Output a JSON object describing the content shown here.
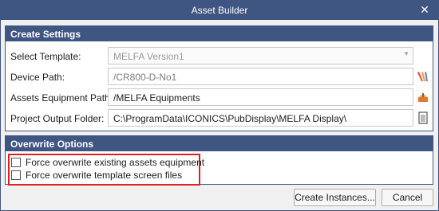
{
  "window": {
    "title": "Asset Builder",
    "close_glyph": "✕"
  },
  "create_settings": {
    "header": "Create Settings",
    "select_template": {
      "label": "Select Template:",
      "value": "MELFA Version1",
      "disabled": true
    },
    "device_path": {
      "label": "Device Path:",
      "value": "/CR800-D-No1",
      "icon": "tag-browse-icon"
    },
    "assets_equipment_path": {
      "label": "Assets Equipment Path:",
      "value": "/MELFA Equipments",
      "icon": "asset-browse-icon"
    },
    "project_output_folder": {
      "label": "Project Output Folder:",
      "value": "C:\\ProgramData\\ICONICS\\PubDisplay\\MELFA Display\\",
      "icon": "folder-browse-icon"
    }
  },
  "overwrite_options": {
    "header": "Overwrite Options",
    "force_assets": {
      "label": "Force overwrite existing assets equipment",
      "checked": false
    },
    "force_screens": {
      "label": "Force overwrite template screen files",
      "checked": false
    },
    "highlight_color": "#e02020"
  },
  "buttons": {
    "create": "Create Instances...",
    "cancel": "Cancel"
  },
  "colors": {
    "title_bar": "#3f5582",
    "group_header": "#3f5582",
    "window_bg": "#f0f0f0"
  }
}
